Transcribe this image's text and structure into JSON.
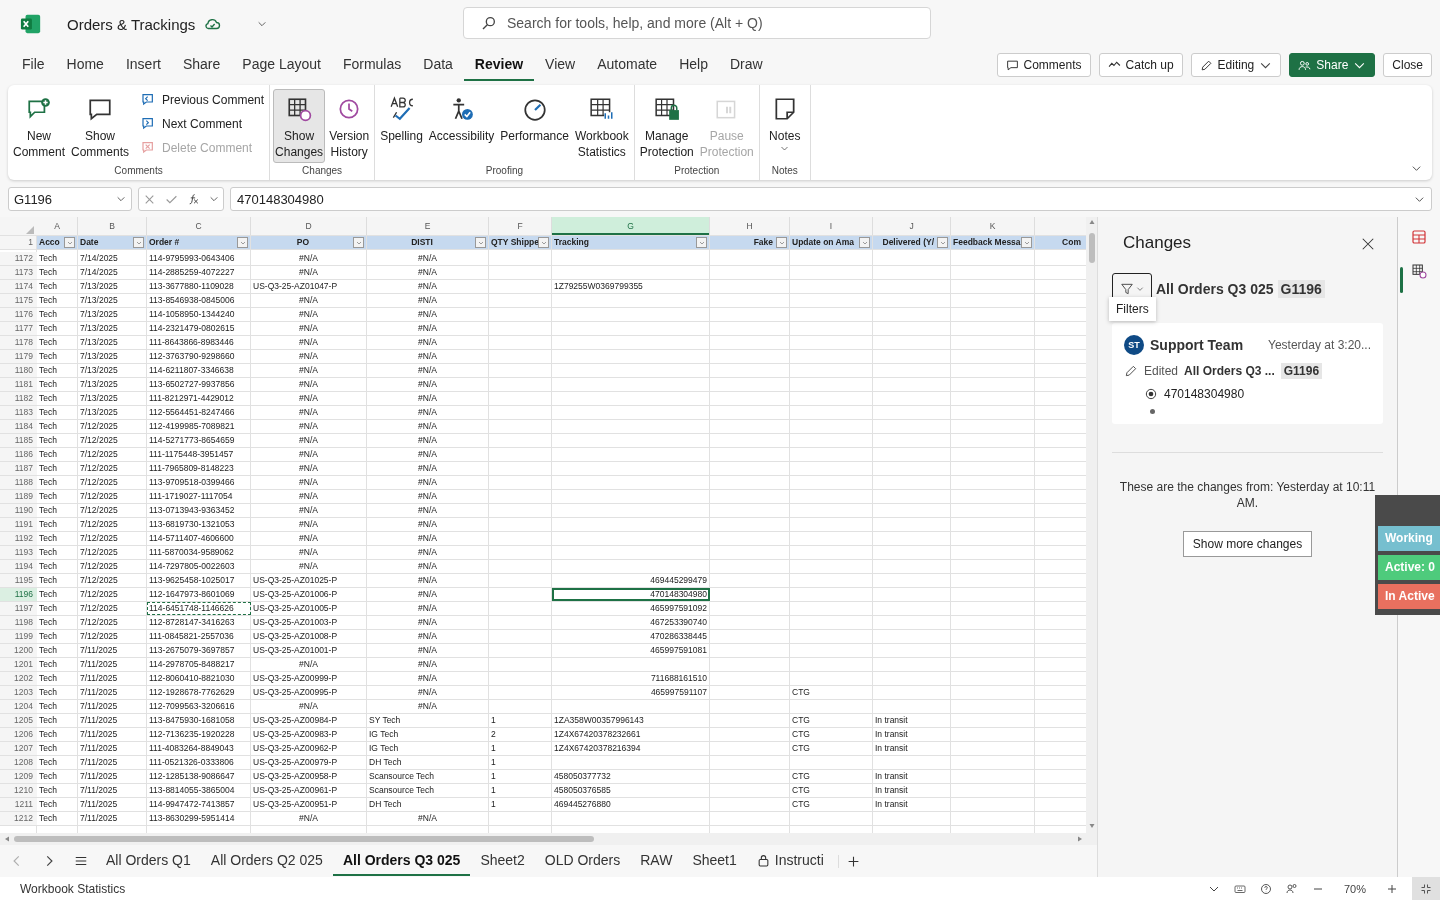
{
  "title_bar": {
    "document": "Orders & Trackings",
    "search_placeholder": "Search for tools, help, and more (Alt + Q)"
  },
  "menu": {
    "tabs": [
      {
        "label": "File",
        "selected": false
      },
      {
        "label": "Home",
        "selected": false
      },
      {
        "label": "Insert",
        "selected": false
      },
      {
        "label": "Share",
        "selected": false
      },
      {
        "label": "Page Layout",
        "selected": false
      },
      {
        "label": "Formulas",
        "selected": false
      },
      {
        "label": "Data",
        "selected": false
      },
      {
        "label": "Review",
        "selected": true
      },
      {
        "label": "View",
        "selected": false
      },
      {
        "label": "Automate",
        "selected": false
      },
      {
        "label": "Help",
        "selected": false
      },
      {
        "label": "Draw",
        "selected": false
      }
    ],
    "buttons": [
      {
        "kind": "comments",
        "label": "Comments"
      },
      {
        "kind": "catchup",
        "label": "Catch up"
      },
      {
        "kind": "editing",
        "label": "Editing"
      },
      {
        "kind": "share",
        "label": "Share"
      },
      {
        "kind": "plain",
        "label": "Close"
      }
    ]
  },
  "ribbon": {
    "groups": [
      {
        "label": "Comments",
        "items": [
          {
            "kind": "large",
            "label": "New\nComment",
            "disabled": false,
            "selected": false
          },
          {
            "kind": "large",
            "label": "Show\nComments",
            "disabled": false,
            "selected": false
          },
          {
            "kind": "small",
            "label": "Previous Comment",
            "disabled": false
          },
          {
            "kind": "small",
            "label": "Next Comment",
            "disabled": false
          },
          {
            "kind": "small",
            "label": "Delete Comment",
            "disabled": true
          }
        ]
      },
      {
        "label": "Changes",
        "items": [
          {
            "kind": "large",
            "label": "Show\nChanges",
            "disabled": false,
            "selected": true
          },
          {
            "kind": "large",
            "label": "Version\nHistory",
            "disabled": false,
            "selected": false
          }
        ]
      },
      {
        "label": "Proofing",
        "items": [
          {
            "kind": "large",
            "label": "Spelling",
            "disabled": false,
            "selected": false
          },
          {
            "kind": "large",
            "label": "Accessibility",
            "disabled": false,
            "selected": false
          },
          {
            "kind": "large",
            "label": "Performance",
            "disabled": false,
            "selected": false
          },
          {
            "kind": "large",
            "label": "Workbook\nStatistics",
            "disabled": false,
            "selected": false
          }
        ]
      },
      {
        "label": "Protection",
        "items": [
          {
            "kind": "large",
            "label": "Manage\nProtection",
            "disabled": false,
            "selected": false
          },
          {
            "kind": "large",
            "label": "Pause\nProtection",
            "disabled": true,
            "selected": false
          }
        ]
      },
      {
        "label": "Notes",
        "items": [
          {
            "kind": "menu",
            "label": "Notes",
            "disabled": false,
            "selected": false
          }
        ]
      }
    ]
  },
  "formula_bar": {
    "name_box": "G1196",
    "formula": "470148304980"
  },
  "sheet": {
    "columns": [
      {
        "letter": "A",
        "header": "Acco",
        "selected": false
      },
      {
        "letter": "B",
        "header": "Date",
        "selected": false
      },
      {
        "letter": "C",
        "header": "Order #",
        "selected": false
      },
      {
        "letter": "D",
        "header": "PO",
        "selected": false
      },
      {
        "letter": "E",
        "header": "DISTI",
        "selected": false
      },
      {
        "letter": "F",
        "header": "QTY Shippe",
        "selected": false
      },
      {
        "letter": "G",
        "header": "Tracking",
        "selected": true
      },
      {
        "letter": "H",
        "header": "Fake",
        "selected": false
      },
      {
        "letter": "I",
        "header": "Update on Ama",
        "selected": false
      },
      {
        "letter": "J",
        "header": "Delivered (Y/",
        "selected": false
      },
      {
        "letter": "K",
        "header": "Feedback Messa",
        "selected": false
      },
      {
        "header": "Com"
      }
    ],
    "header_row": "1",
    "rows": [
      {
        "n": "1172",
        "a": "Tech",
        "b": "7/14/2025",
        "c": "114-9795993-0643406",
        "d": "#N/A",
        "e": "#N/A",
        "po_error": true,
        "disti_error": true,
        "selected": false
      },
      {
        "n": "1173",
        "a": "Tech",
        "b": "7/14/2025",
        "c": "114-2885259-4072227",
        "d": "#N/A",
        "e": "#N/A",
        "po_error": true,
        "disti_error": true,
        "selected": false
      },
      {
        "n": "1174",
        "a": "Tech",
        "b": "7/13/2025",
        "c": "113-3677880-1109028",
        "d": "US-Q3-25-AZ01047-P",
        "e": "#N/A",
        "g": "1Z79255W0369799355",
        "disti_error": true,
        "selected": false
      },
      {
        "n": "1175",
        "a": "Tech",
        "b": "7/13/2025",
        "c": "113-8546938-0845006",
        "d": "#N/A",
        "e": "#N/A",
        "po_error": true,
        "disti_error": true,
        "selected": false
      },
      {
        "n": "1176",
        "a": "Tech",
        "b": "7/13/2025",
        "c": "114-1058950-1344240",
        "d": "#N/A",
        "e": "#N/A",
        "po_error": true,
        "disti_error": true,
        "selected": false
      },
      {
        "n": "1177",
        "a": "Tech",
        "b": "7/13/2025",
        "c": "114-2321479-0802615",
        "d": "#N/A",
        "e": "#N/A",
        "po_error": true,
        "disti_error": true,
        "selected": false
      },
      {
        "n": "1178",
        "a": "Tech",
        "b": "7/13/2025",
        "c": "111-8643866-8983446",
        "d": "#N/A",
        "e": "#N/A",
        "po_error": true,
        "disti_error": true,
        "selected": false
      },
      {
        "n": "1179",
        "a": "Tech",
        "b": "7/13/2025",
        "c": "112-3763790-9298660",
        "d": "#N/A",
        "e": "#N/A",
        "po_error": true,
        "disti_error": true,
        "selected": false
      },
      {
        "n": "1180",
        "a": "Tech",
        "b": "7/13/2025",
        "c": "114-6211807-3346638",
        "d": "#N/A",
        "e": "#N/A",
        "po_error": true,
        "disti_error": true,
        "selected": false
      },
      {
        "n": "1181",
        "a": "Tech",
        "b": "7/13/2025",
        "c": "113-6502727-9937856",
        "d": "#N/A",
        "e": "#N/A",
        "po_error": true,
        "disti_error": true,
        "selected": false
      },
      {
        "n": "1182",
        "a": "Tech",
        "b": "7/13/2025",
        "c": "111-8212971-4429012",
        "d": "#N/A",
        "e": "#N/A",
        "po_error": true,
        "disti_error": true,
        "selected": false
      },
      {
        "n": "1183",
        "a": "Tech",
        "b": "7/13/2025",
        "c": "112-5564451-8247466",
        "d": "#N/A",
        "e": "#N/A",
        "po_error": true,
        "disti_error": true,
        "selected": false
      },
      {
        "n": "1184",
        "a": "Tech",
        "b": "7/12/2025",
        "c": "112-4199985-7089821",
        "d": "#N/A",
        "e": "#N/A",
        "po_error": true,
        "disti_error": true,
        "selected": false
      },
      {
        "n": "1185",
        "a": "Tech",
        "b": "7/12/2025",
        "c": "114-5271773-8654659",
        "d": "#N/A",
        "e": "#N/A",
        "po_error": true,
        "disti_error": true,
        "selected": false
      },
      {
        "n": "1186",
        "a": "Tech",
        "b": "7/12/2025",
        "c": "111-1175448-3951457",
        "d": "#N/A",
        "e": "#N/A",
        "po_error": true,
        "disti_error": true,
        "selected": false
      },
      {
        "n": "1187",
        "a": "Tech",
        "b": "7/12/2025",
        "c": "111-7965809-8148223",
        "d": "#N/A",
        "e": "#N/A",
        "po_error": true,
        "disti_error": true,
        "selected": false
      },
      {
        "n": "1188",
        "a": "Tech",
        "b": "7/12/2025",
        "c": "113-9709518-0399466",
        "d": "#N/A",
        "e": "#N/A",
        "po_error": true,
        "disti_error": true,
        "selected": false
      },
      {
        "n": "1189",
        "a": "Tech",
        "b": "7/12/2025",
        "c": "111-1719027-1117054",
        "d": "#N/A",
        "e": "#N/A",
        "po_error": true,
        "disti_error": true,
        "selected": false
      },
      {
        "n": "1190",
        "a": "Tech",
        "b": "7/12/2025",
        "c": "113-0713943-9363452",
        "d": "#N/A",
        "e": "#N/A",
        "po_error": true,
        "disti_error": true,
        "selected": false
      },
      {
        "n": "1191",
        "a": "Tech",
        "b": "7/12/2025",
        "c": "113-6819730-1321053",
        "d": "#N/A",
        "e": "#N/A",
        "po_error": true,
        "disti_error": true,
        "selected": false
      },
      {
        "n": "1192",
        "a": "Tech",
        "b": "7/12/2025",
        "c": "114-5711407-4606600",
        "d": "#N/A",
        "e": "#N/A",
        "po_error": true,
        "disti_error": true,
        "selected": false
      },
      {
        "n": "1193",
        "a": "Tech",
        "b": "7/12/2025",
        "c": "111-5870034-9589062",
        "d": "#N/A",
        "e": "#N/A",
        "po_error": true,
        "disti_error": true,
        "selected": false
      },
      {
        "n": "1194",
        "a": "Tech",
        "b": "7/12/2025",
        "c": "114-7297805-0022603",
        "d": "#N/A",
        "e": "#N/A",
        "po_error": true,
        "disti_error": true,
        "selected": false
      },
      {
        "n": "1195",
        "a": "Tech",
        "b": "7/12/2025",
        "c": "113-9625458-1025017",
        "d": "US-Q3-25-AZ01025-P",
        "e": "#N/A",
        "g": "469445299479",
        "disti_error": true,
        "tracking_numeric": true,
        "selected": false
      },
      {
        "n": "1196",
        "a": "Tech",
        "b": "7/12/2025",
        "c": "112-1647973-8601069",
        "d": "US-Q3-25-AZ01006-P",
        "e": "#N/A",
        "g": "470148304980",
        "disti_error": true,
        "tracking_numeric": true,
        "selected": true
      },
      {
        "n": "1197",
        "a": "Tech",
        "b": "7/12/2025",
        "c": "114-6451748-1146626",
        "d": "US-Q3-25-AZ01005-P",
        "e": "#N/A",
        "g": "465997591092",
        "disti_error": true,
        "tracking_numeric": true,
        "selected": false,
        "copied": true
      },
      {
        "n": "1198",
        "a": "Tech",
        "b": "7/12/2025",
        "c": "112-8728147-3416263",
        "d": "US-Q3-25-AZ01003-P",
        "e": "#N/A",
        "g": "467253390740",
        "disti_error": true,
        "tracking_numeric": true,
        "selected": false
      },
      {
        "n": "1199",
        "a": "Tech",
        "b": "7/12/2025",
        "c": "111-0845821-2557036",
        "d": "US-Q3-25-AZ01008-P",
        "e": "#N/A",
        "g": "470286338445",
        "disti_error": true,
        "tracking_numeric": true,
        "selected": false
      },
      {
        "n": "1200",
        "a": "Tech",
        "b": "7/11/2025",
        "c": "113-2675079-3697857",
        "d": "US-Q3-25-AZ01001-P",
        "e": "#N/A",
        "g": "465997591081",
        "disti_error": true,
        "tracking_numeric": true,
        "selected": false
      },
      {
        "n": "1201",
        "a": "Tech",
        "b": "7/11/2025",
        "c": "114-2978705-8488217",
        "d": "#N/A",
        "e": "#N/A",
        "po_error": true,
        "disti_error": true,
        "selected": false
      },
      {
        "n": "1202",
        "a": "Tech",
        "b": "7/11/2025",
        "c": "112-8060410-8821030",
        "d": "US-Q3-25-AZ00999-P",
        "e": "#N/A",
        "g": "711688161510",
        "disti_error": true,
        "tracking_numeric": true,
        "selected": false
      },
      {
        "n": "1203",
        "a": "Tech",
        "b": "7/11/2025",
        "c": "112-1928678-7762629",
        "d": "US-Q3-25-AZ00995-P",
        "e": "#N/A",
        "g": "465997591107",
        "i": "CTG",
        "disti_error": true,
        "tracking_numeric": true,
        "selected": false
      },
      {
        "n": "1204",
        "a": "Tech",
        "b": "7/11/2025",
        "c": "112-7099563-3206616",
        "d": "#N/A",
        "e": "#N/A",
        "po_error": true,
        "disti_error": true,
        "selected": false
      },
      {
        "n": "1205",
        "a": "Tech",
        "b": "7/11/2025",
        "c": "113-8475930-1681058",
        "d": "US-Q3-25-AZ00984-P",
        "e": "SY Tech",
        "f": "1",
        "g": "1ZA358W00357996143",
        "i": "CTG",
        "j": "In transit",
        "selected": false
      },
      {
        "n": "1206",
        "a": "Tech",
        "b": "7/11/2025",
        "c": "112-7136235-1920228",
        "d": "US-Q3-25-AZ00983-P",
        "e": "IG Tech",
        "f": "2",
        "g": "1Z4X67420378232661",
        "i": "CTG",
        "j": "In transit",
        "selected": false
      },
      {
        "n": "1207",
        "a": "Tech",
        "b": "7/11/2025",
        "c": "111-4083264-8849043",
        "d": "US-Q3-25-AZ00962-P",
        "e": "IG Tech",
        "f": "1",
        "g": "1Z4X67420378216394",
        "i": "CTG",
        "j": "In transit",
        "selected": false
      },
      {
        "n": "1208",
        "a": "Tech",
        "b": "7/11/2025",
        "c": "111-0521326-0333806",
        "d": "US-Q3-25-AZ00979-P",
        "e": "DH Tech",
        "f": "1",
        "selected": false
      },
      {
        "n": "1209",
        "a": "Tech",
        "b": "7/11/2025",
        "c": "112-1285138-9086647",
        "d": "US-Q3-25-AZ00958-P",
        "e": "Scansource Tech",
        "f": "1",
        "g": "458050377732",
        "i": "CTG",
        "j": "In transit",
        "selected": false
      },
      {
        "n": "1210",
        "a": "Tech",
        "b": "7/11/2025",
        "c": "113-8814055-3865004",
        "d": "US-Q3-25-AZ00961-P",
        "e": "Scansource Tech",
        "f": "1",
        "g": "458050376585",
        "i": "CTG",
        "j": "In transit",
        "selected": false
      },
      {
        "n": "1211",
        "a": "Tech",
        "b": "7/11/2025",
        "c": "114-9947472-7413857",
        "d": "US-Q3-25-AZ00951-P",
        "e": "DH Tech",
        "f": "1",
        "g": "469445276880",
        "i": "CTG",
        "j": "In transit",
        "selected": false
      },
      {
        "n": "1212",
        "a": "Tech",
        "b": "7/11/2025",
        "c": "113-8630299-5951414",
        "d": "#N/A",
        "e": "#N/A",
        "po_error": true,
        "disti_error": true,
        "selected": false
      }
    ]
  },
  "sheet_tabs": [
    {
      "label": "All Orders Q1",
      "selected": false,
      "locked": false
    },
    {
      "label": "All Orders Q2 025",
      "selected": false,
      "locked": false
    },
    {
      "label": "All Orders Q3 025",
      "selected": true,
      "locked": false
    },
    {
      "label": "Sheet2",
      "selected": false,
      "locked": false
    },
    {
      "label": "OLD Orders",
      "selected": false,
      "locked": false
    },
    {
      "label": "RAW",
      "selected": false,
      "locked": false
    },
    {
      "label": "Sheet1",
      "selected": false,
      "locked": false
    },
    {
      "label": "Instructi",
      "selected": false,
      "locked": true
    }
  ],
  "changes_pane": {
    "title": "Changes",
    "filter_tooltip": "Filters",
    "scope_sheet": "All Orders Q3 025",
    "scope_cell": "G1196",
    "entries": [
      {
        "avatar": "ST",
        "author": "Support Team",
        "time": "Yesterday at 3:20...",
        "action": "Edited",
        "sheet": "All Orders Q3 ...",
        "cell": "G1196",
        "value": "470148304980"
      }
    ],
    "footer_note": "These are the changes from: Yesterday at 10:11 AM.",
    "more_button": "Show more changes"
  },
  "status_widget": {
    "items": [
      {
        "label": "Working",
        "color": "#76bfcf"
      },
      {
        "label": "Active: 0",
        "color": "#4ecb7c"
      },
      {
        "label": "In Active",
        "color": "#e8705f"
      }
    ]
  },
  "status_bar": {
    "left": "Workbook Statistics",
    "zoom": "70%"
  }
}
